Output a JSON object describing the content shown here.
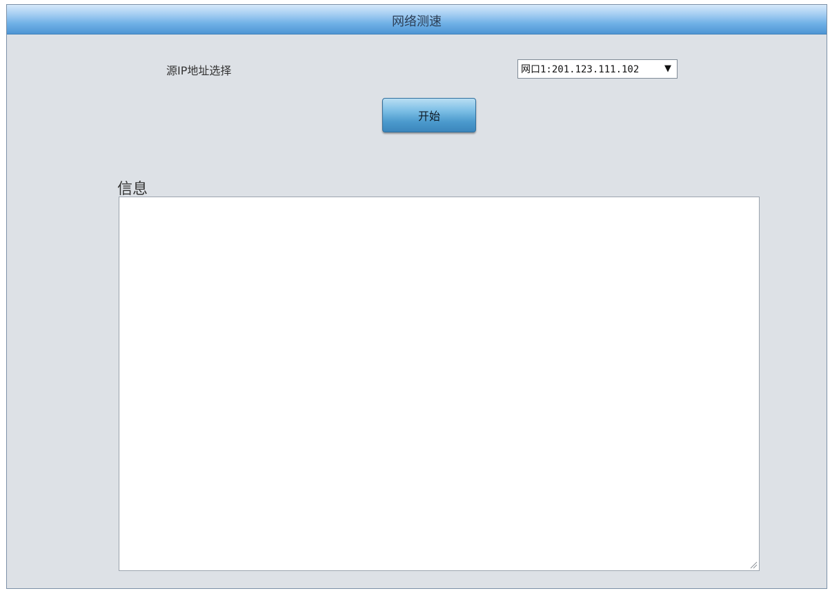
{
  "header": {
    "title": "网络测速"
  },
  "form": {
    "source_ip_label": "源IP地址选择",
    "source_ip_selected": "网口1:201.123.111.102",
    "start_button_label": "开始"
  },
  "info": {
    "label": "信息",
    "content": ""
  },
  "icons": {
    "dropdown": "dropdown-arrow-icon",
    "resize": "resize-grip-icon"
  },
  "colors": {
    "header_gradient_top": "#d6e9fa",
    "header_gradient_bottom": "#4f96d4",
    "panel_background": "#dde1e6",
    "button_gradient_top": "#b9def3",
    "button_gradient_bottom": "#3b86bc"
  }
}
